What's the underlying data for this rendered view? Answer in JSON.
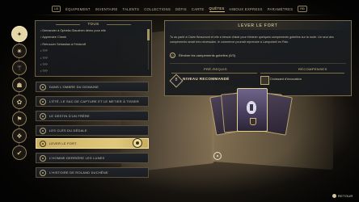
{
  "topnav": {
    "left_key": "LB",
    "right_key": "RB",
    "tabs": [
      {
        "label": "ÉQUIPEMENT"
      },
      {
        "label": "INVENTAIRE"
      },
      {
        "label": "TALENTS"
      },
      {
        "label": "COLLECTIONS"
      },
      {
        "label": "DÉFIS"
      },
      {
        "label": "CARTE"
      },
      {
        "label": "QUÊTES"
      },
      {
        "label": "HIBOUX EXPRESS"
      },
      {
        "label": "PARAMÈTRES"
      }
    ],
    "active_tab": "QUÊTES"
  },
  "categories": [
    {
      "icon": "compass-icon",
      "glyph": "✦",
      "active": true
    },
    {
      "icon": "star-icon",
      "glyph": "✷",
      "active": false
    },
    {
      "icon": "wand-icon",
      "glyph": "⚚",
      "active": false
    },
    {
      "icon": "person-icon",
      "glyph": "☗",
      "active": false
    },
    {
      "icon": "beast-icon",
      "glyph": "✿",
      "active": false
    },
    {
      "icon": "flag-icon",
      "glyph": "⚑",
      "active": false
    },
    {
      "icon": "book-icon",
      "glyph": "❖",
      "active": false
    },
    {
      "icon": "check-icon",
      "glyph": "✔",
      "active": false
    }
  ],
  "todo": {
    "header": "TOUS",
    "items": [
      "Demander à Ophelia Glaushen démo pour elle",
      "Apprendre Cheek",
      "Retrouver Sebastian à Feldcroft",
      "???",
      "???",
      "???",
      "???"
    ]
  },
  "quests": [
    {
      "label": "DANS L'OMBRE DU DOMAINE",
      "selected": false
    },
    {
      "label": "L'ÉTÉ, LE SAC DE CAPTURE ET LE METIER À TISSER",
      "selected": false
    },
    {
      "label": "LE DESTIN D'UN FRÈRE",
      "selected": false
    },
    {
      "label": "LES CLÉS DU DÉDALE",
      "selected": false
    },
    {
      "label": "LEVER LE FORT",
      "selected": true
    },
    {
      "label": "L'HOMME DERRIÈRE LES LUNES",
      "selected": false
    },
    {
      "label": "L'HISTOIRE DE ROLAND DUCHÊNE",
      "selected": false
    }
  ],
  "detail": {
    "title": "LEVER LE FORT",
    "description": "Tu as parlé à Claire Beaumont et elle a besoin d'aide pour éliminer quelques campements gobelins sur la route. Un seul des campements serait très nécessaire, le commerce pourrait reprendre à Lampoldeli en Paix.",
    "objective": "Éliminer les campements gobelins (0/3)",
    "prereq_label": "PRÉ-REQUIS",
    "rewards_label": "RÉCOMPENSES",
    "level_text": "NIVEAU RECOMMANDÉ",
    "level_value": "8",
    "reward_text": "Croissant d'invocation"
  },
  "bottom": {
    "back_label": "RETOUR"
  }
}
